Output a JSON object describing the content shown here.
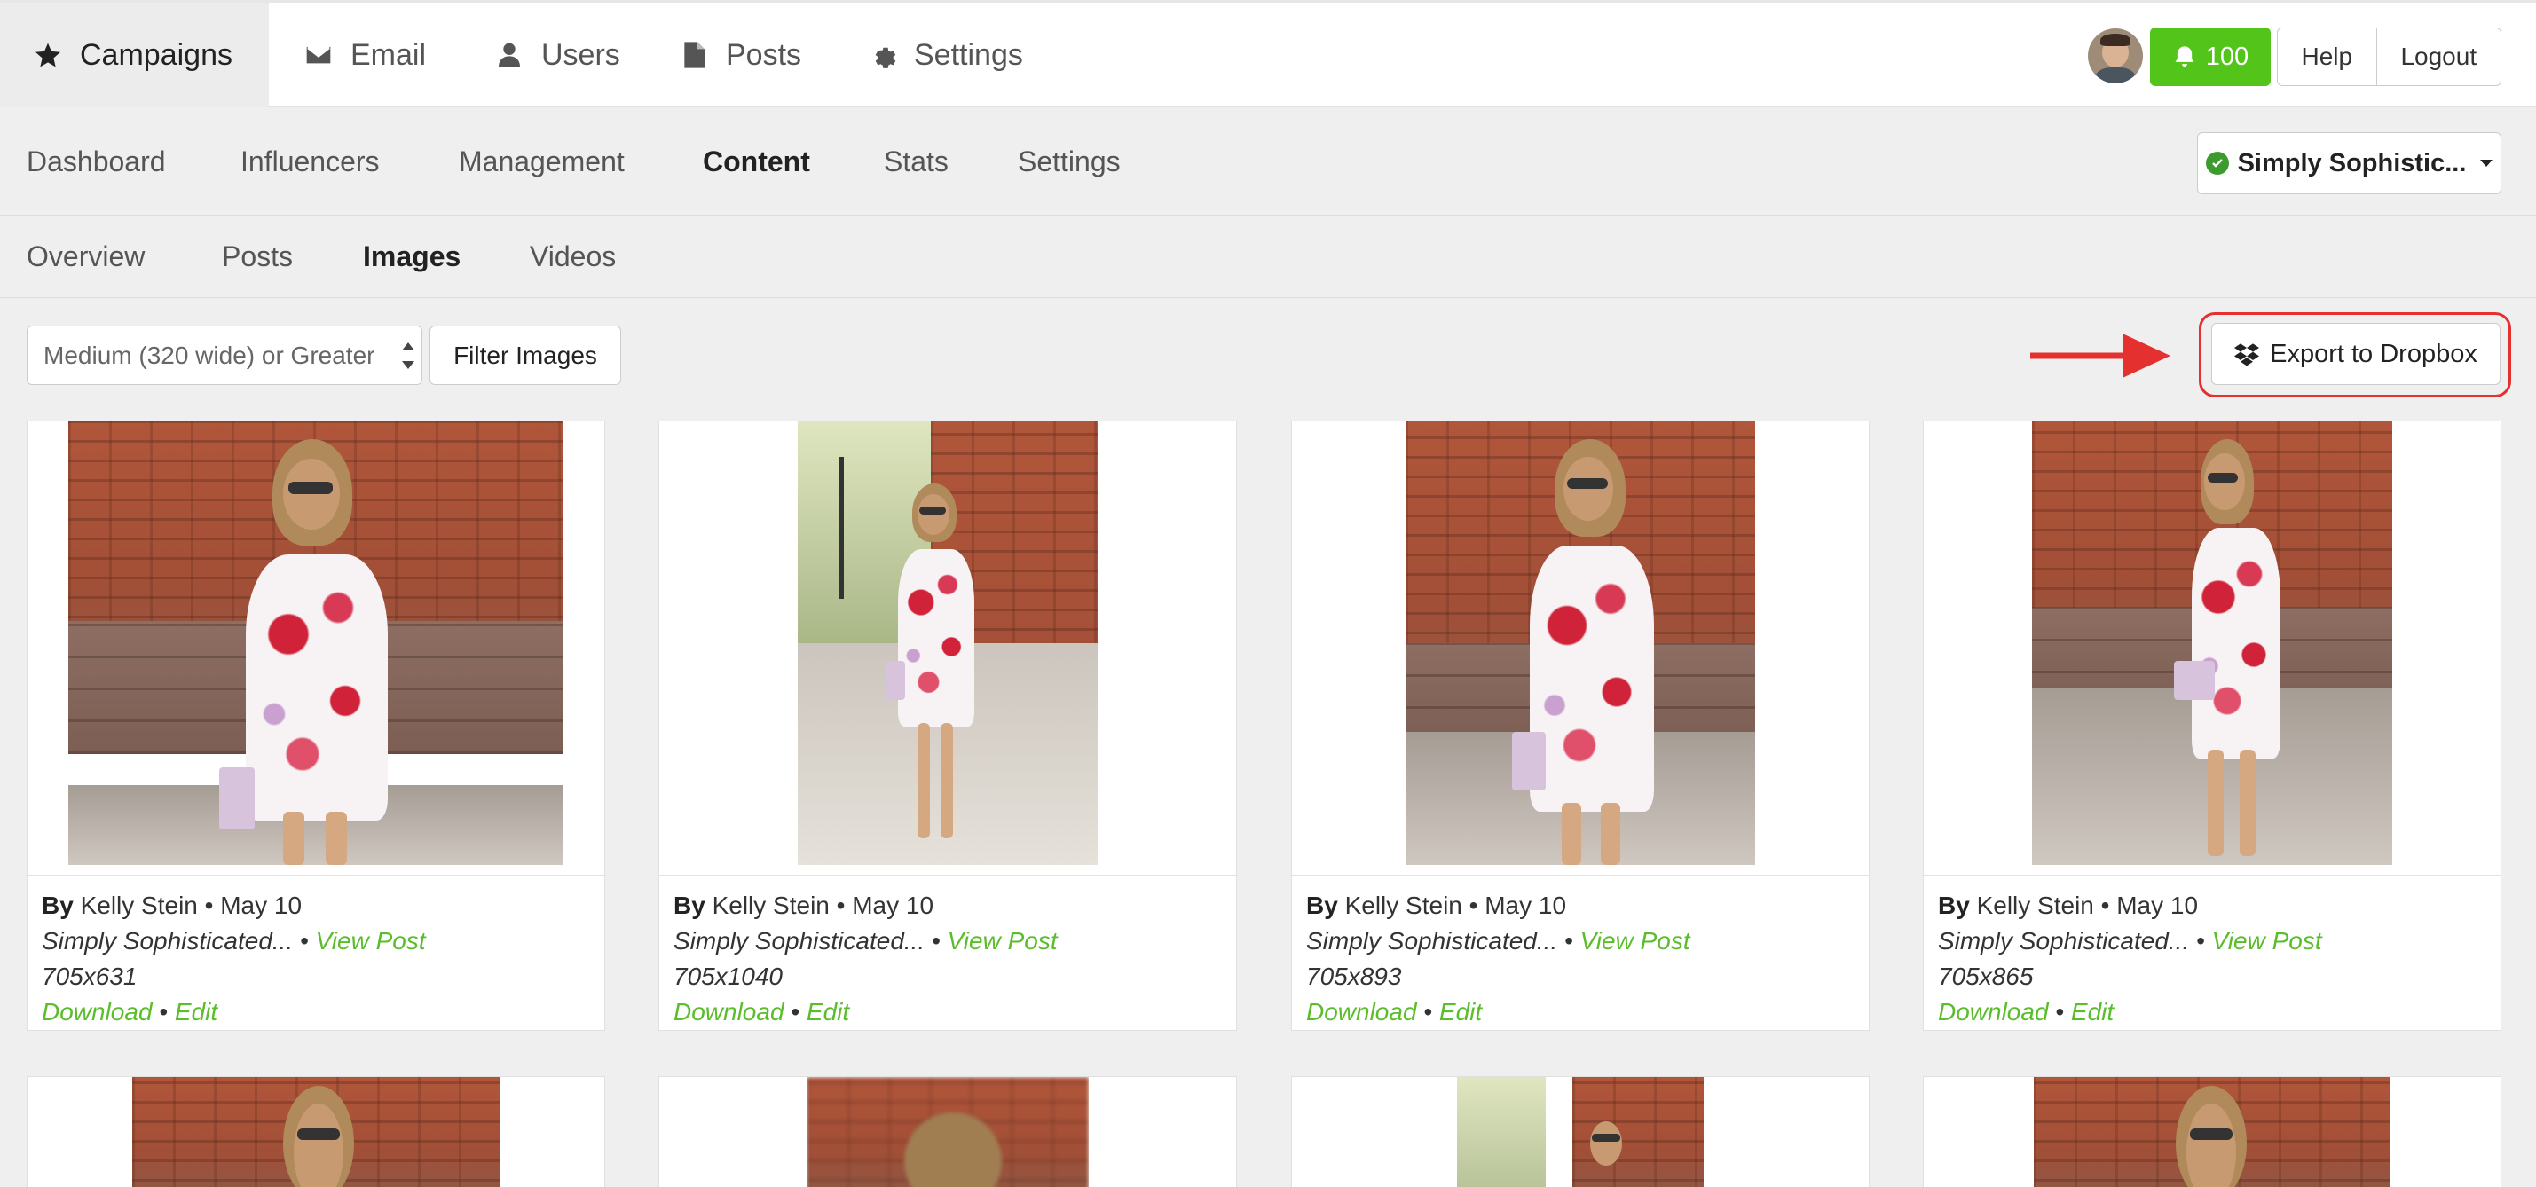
{
  "topnav": {
    "items": [
      {
        "label": "Campaigns",
        "icon": "star-icon",
        "active": true
      },
      {
        "label": "Email",
        "icon": "envelope-icon",
        "active": false
      },
      {
        "label": "Users",
        "icon": "user-icon",
        "active": false
      },
      {
        "label": "Posts",
        "icon": "file-icon",
        "active": false
      },
      {
        "label": "Settings",
        "icon": "gear-icon",
        "active": false
      }
    ],
    "notifications": "100",
    "help": "Help",
    "logout": "Logout"
  },
  "subnav": {
    "items": [
      "Dashboard",
      "Influencers",
      "Management",
      "Content",
      "Stats",
      "Settings"
    ],
    "active": "Content",
    "campaign": "Simply Sophistic..."
  },
  "tertnav": {
    "items": [
      "Overview",
      "Posts",
      "Images",
      "Videos"
    ],
    "active": "Images"
  },
  "filters": {
    "size_select": "Medium (320 wide) or Greater",
    "filter_button": "Filter Images",
    "export_button": "Export to Dropbox"
  },
  "cards": [
    {
      "by": "By",
      "author": " Kelly Stein • May 10",
      "blog": "Simply Sophisticated...",
      "sep": " • ",
      "view": "View Post",
      "dims": "705x631",
      "download": "Download",
      "sep2": " • ",
      "edit": "Edit"
    },
    {
      "by": "By",
      "author": " Kelly Stein • May 10",
      "blog": "Simply Sophisticated...",
      "sep": " • ",
      "view": "View Post",
      "dims": "705x1040",
      "download": "Download",
      "sep2": " • ",
      "edit": "Edit"
    },
    {
      "by": "By",
      "author": " Kelly Stein • May 10",
      "blog": "Simply Sophisticated...",
      "sep": " • ",
      "view": "View Post",
      "dims": "705x893",
      "download": "Download",
      "sep2": " • ",
      "edit": "Edit"
    },
    {
      "by": "By",
      "author": " Kelly Stein • May 10",
      "blog": "Simply Sophisticated...",
      "sep": " • ",
      "view": "View Post",
      "dims": "705x865",
      "download": "Download",
      "sep2": " • ",
      "edit": "Edit"
    }
  ],
  "colors": {
    "accent_green": "#52c41a",
    "link_green": "#5bbd2b",
    "annotation_red": "#e53030"
  }
}
